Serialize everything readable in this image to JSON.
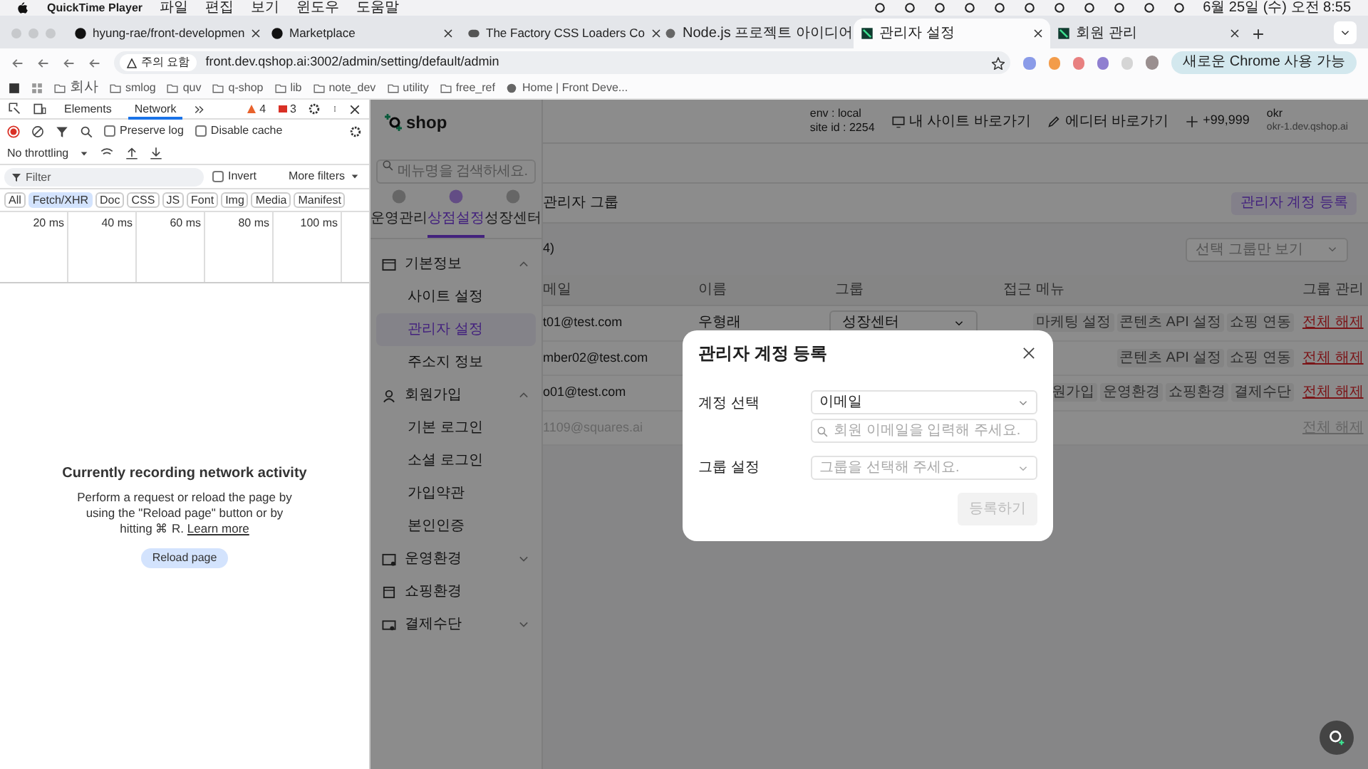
{
  "menubar": {
    "app": "QuickTime Player",
    "menus": [
      "파일",
      "편집",
      "보기",
      "윈도우",
      "도움말"
    ],
    "clock": "6월 25일 (수) 오전 8:55"
  },
  "browser": {
    "tabs": [
      {
        "title": "hyung-rae/front-developmen",
        "kind": "github",
        "selected": false
      },
      {
        "title": "Marketplace",
        "kind": "github",
        "selected": false
      },
      {
        "title": "The Factory CSS Loaders Co",
        "kind": "css",
        "selected": false
      },
      {
        "title": "Node.js 프로젝트 아이디어",
        "kind": "globe",
        "selected": false
      },
      {
        "title": "관리자 설정",
        "kind": "app",
        "selected": true
      },
      {
        "title": "회원 관리",
        "kind": "app",
        "selected": false
      }
    ],
    "security": "주의 요함",
    "url": "front.dev.qshop.ai:3002/admin/setting/default/admin",
    "update_button": "새로운 Chrome 사용 가능",
    "bookmarks": [
      {
        "label": "회사",
        "kind": "folder"
      },
      {
        "label": "smlog",
        "kind": "folder"
      },
      {
        "label": "quv",
        "kind": "folder"
      },
      {
        "label": "q-shop",
        "kind": "folder"
      },
      {
        "label": "lib",
        "kind": "folder"
      },
      {
        "label": "note_dev",
        "kind": "folder"
      },
      {
        "label": "utility",
        "kind": "folder"
      },
      {
        "label": "free_ref",
        "kind": "folder"
      },
      {
        "label": "Home | Front Deve...",
        "kind": "page"
      }
    ]
  },
  "devtools": {
    "tabs": [
      {
        "label": "Elements",
        "selected": false
      },
      {
        "label": "Network",
        "selected": true
      }
    ],
    "warnings": "4",
    "errors": "3",
    "options": [
      {
        "label": "Preserve log",
        "checked": false
      },
      {
        "label": "Disable cache",
        "checked": false
      }
    ],
    "throttling": "No throttling",
    "filter": {
      "placeholder": "Filter"
    },
    "invert": {
      "label": "Invert",
      "checked": false
    },
    "more_filters": "More filters",
    "types": [
      {
        "label": "All",
        "selected": false
      },
      {
        "label": "Fetch/XHR",
        "selected": true
      },
      {
        "label": "Doc",
        "selected": false
      },
      {
        "label": "CSS",
        "selected": false
      },
      {
        "label": "JS",
        "selected": false
      },
      {
        "label": "Font",
        "selected": false
      },
      {
        "label": "Img",
        "selected": false
      },
      {
        "label": "Media",
        "selected": false
      },
      {
        "label": "Manifest",
        "selected": false
      }
    ],
    "timeline_ticks": [
      "20 ms",
      "40 ms",
      "60 ms",
      "80 ms",
      "100 ms"
    ],
    "empty": {
      "title": "Currently recording network activity",
      "body": "Perform a request or reload the page by using the \"Reload page\" button or by hitting ⌘ R.",
      "link": "Learn more",
      "button": "Reload page"
    }
  },
  "app": {
    "logo": "shop",
    "env": "env : local",
    "site_id": "site id : 2254",
    "links": [
      {
        "label": "내 사이트 바로가기",
        "kind": "monitor"
      },
      {
        "label": "에디터 바로가기",
        "kind": "pencil"
      },
      {
        "label": "+99,999",
        "kind": "sparkle"
      }
    ],
    "user": {
      "name": "okr",
      "domain": "okr-1.dev.qshop.ai"
    },
    "sidebar": {
      "search": {
        "placeholder": "메뉴명을 검색하세요."
      },
      "tabs": [
        {
          "label": "운영관리",
          "selected": false
        },
        {
          "label": "상점설정",
          "selected": true
        },
        {
          "label": "성장센터",
          "selected": false
        }
      ],
      "items": [
        {
          "label": "기본정보",
          "kind": "card",
          "expanded": true,
          "children": [
            {
              "label": "사이트 설정",
              "selected": false
            },
            {
              "label": "관리자 설정",
              "selected": true
            },
            {
              "label": "주소지 정보",
              "selected": false
            }
          ]
        },
        {
          "label": "회원가입",
          "kind": "user",
          "expanded": true,
          "children": [
            {
              "label": "기본 로그인",
              "selected": false
            },
            {
              "label": "소셜 로그인",
              "selected": false
            },
            {
              "label": "가입약관",
              "selected": false
            },
            {
              "label": "본인인증",
              "selected": false
            }
          ]
        },
        {
          "label": "운영환경",
          "kind": "window",
          "expanded": false
        },
        {
          "label": "쇼핑환경",
          "kind": "store"
        },
        {
          "label": "결제수단",
          "kind": "payment",
          "expanded": false
        }
      ]
    },
    "page": {
      "title": "관리자 그룹",
      "add_button": "관리자 계정 등록",
      "count": "4)",
      "group_filter": "선택 그룹만 보기",
      "table": {
        "columns": [
          "메일",
          "이름",
          "그룹",
          "접근 메뉴",
          "그룹 관리"
        ],
        "rows": [
          {
            "email": "t01@test.com",
            "name": "우형래",
            "group": "성장센터",
            "menus": [
              "마케팅 설정",
              "콘텐츠 API 설정",
              "쇼핑 연동"
            ],
            "action": "전체 해제",
            "disabled": false
          },
          {
            "email": "mber02@test.com",
            "menus": [
              "콘텐츠 API 설정",
              "쇼핑 연동"
            ],
            "action": "전체 해제",
            "disabled": false
          },
          {
            "email": "o01@test.com",
            "menus": [
              "원가입",
              "운영환경",
              "쇼핑환경",
              "결제수단"
            ],
            "action": "전체 해제",
            "disabled": false
          },
          {
            "email": "1109@squares.ai",
            "menus": [],
            "action": "전체 해제",
            "disabled": true
          }
        ]
      }
    },
    "modal": {
      "title": "관리자 계정 등록",
      "account_label": "계정 선택",
      "account_value": "이메일",
      "email_search": {
        "placeholder": "회원 이메일을 입력해 주세요."
      },
      "group_label": "그룹 설정",
      "group_select": {
        "placeholder": "그룹을 선택해 주세요."
      },
      "submit": {
        "label": "등록하기",
        "disabled": true
      }
    }
  }
}
